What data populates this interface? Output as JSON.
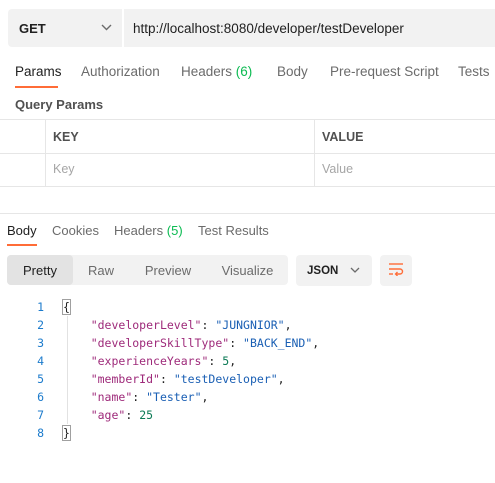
{
  "request": {
    "method": "GET",
    "url": "http://localhost:8080/developer/testDeveloper"
  },
  "request_tabs": {
    "params": "Params",
    "authorization": "Authorization",
    "headers": "Headers",
    "headers_count": "(6)",
    "body": "Body",
    "prerequest": "Pre-request Script",
    "tests": "Tests"
  },
  "query_params": {
    "title": "Query Params",
    "key_header": "KEY",
    "value_header": "VALUE",
    "key_placeholder": "Key",
    "value_placeholder": "Value"
  },
  "response_tabs": {
    "body": "Body",
    "cookies": "Cookies",
    "headers": "Headers",
    "headers_count": "(5)",
    "test_results": "Test Results"
  },
  "view_modes": {
    "pretty": "Pretty",
    "raw": "Raw",
    "preview": "Preview",
    "visualize": "Visualize"
  },
  "format": "JSON",
  "response_body": {
    "line_numbers": [
      "1",
      "2",
      "3",
      "4",
      "5",
      "6",
      "7",
      "8"
    ],
    "open_brace": "{",
    "close_brace": "}",
    "fields": [
      {
        "key": "\"developerLevel\"",
        "value": "\"JUNGNIOR\"",
        "sep": ",",
        "type": "string"
      },
      {
        "key": "\"developerSkillType\"",
        "value": "\"BACK_END\"",
        "sep": ",",
        "type": "string"
      },
      {
        "key": "\"experienceYears\"",
        "value": "5",
        "sep": ",",
        "type": "number"
      },
      {
        "key": "\"memberId\"",
        "value": "\"testDeveloper\"",
        "sep": ",",
        "type": "string"
      },
      {
        "key": "\"name\"",
        "value": "\"Tester\"",
        "sep": ",",
        "type": "string"
      },
      {
        "key": "\"age\"",
        "value": "25",
        "sep": "",
        "type": "number"
      }
    ]
  },
  "colors": {
    "accent": "#ff6c37",
    "count_green": "#0cbb52",
    "json_key": "#9e2a7a",
    "json_string": "#1a5fb4",
    "json_number": "#0b7a55",
    "line_number": "#1c7bcc"
  },
  "icons": {
    "method_dropdown": "chevron-down-icon",
    "format_dropdown": "chevron-down-icon",
    "wrap": "wrap-lines-icon"
  }
}
